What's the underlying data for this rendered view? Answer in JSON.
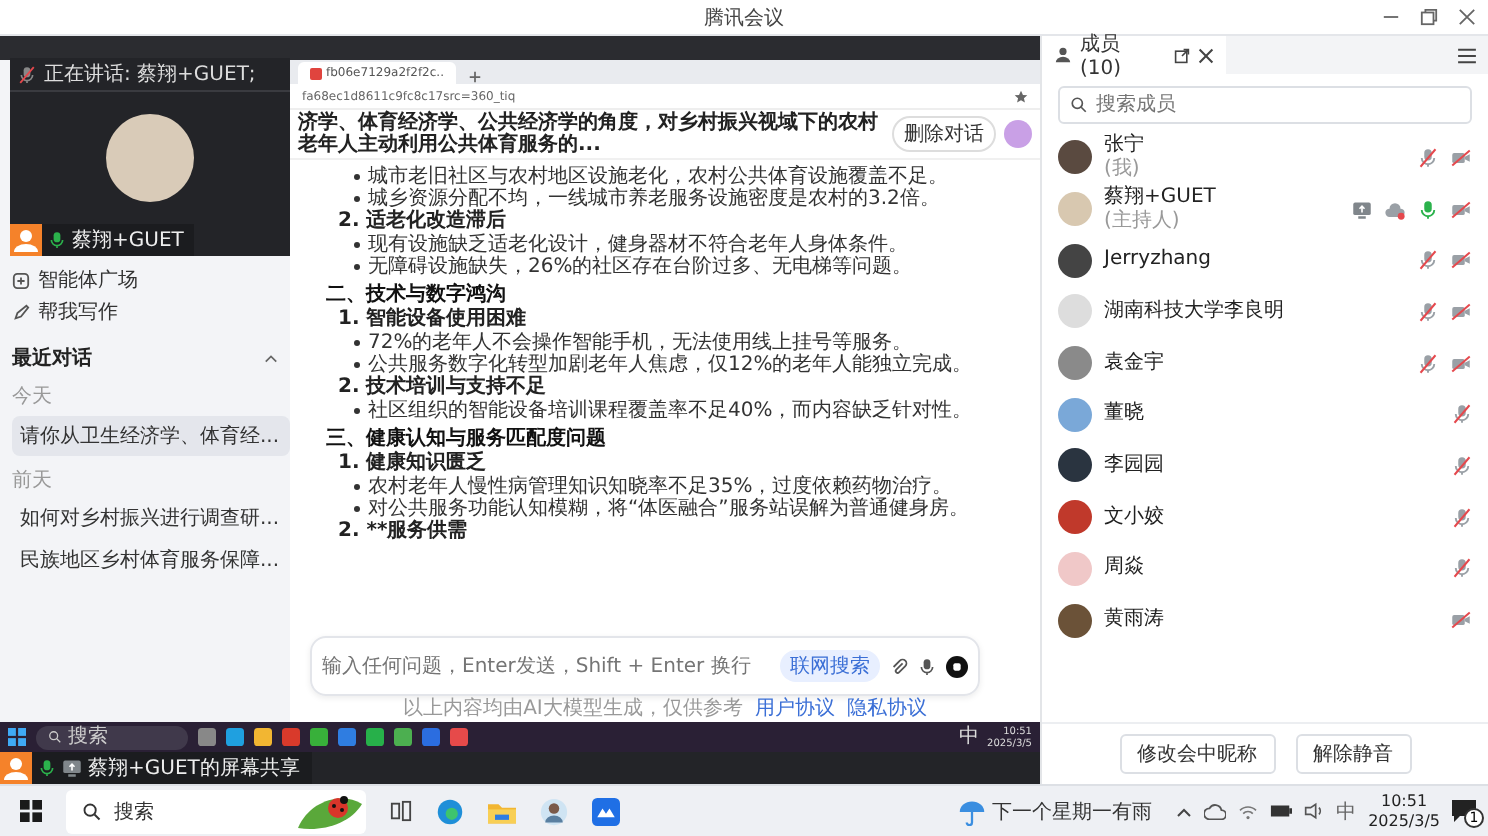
{
  "window": {
    "title": "腾讯会议"
  },
  "speaker_overlay": {
    "speaking": "正在讲话: 蔡翔+GUET;",
    "name": "蔡翔+GUET"
  },
  "share_label": "蔡翔+GUET的屏幕共享",
  "shared_screen": {
    "browser": {
      "tab": "fb06e7129a2f2f2c..",
      "url": "fa68ec1d8611c9fc8c17src=360_tiq"
    },
    "sidebar": {
      "items": [
        {
          "label": "智能体广场"
        },
        {
          "label": "帮我写作"
        }
      ],
      "section": "最近对话",
      "groups": [
        {
          "label": "今天",
          "conversations": [
            {
              "label": "请你从卫生经济学、体育经...",
              "selected": true
            }
          ]
        },
        {
          "label": "前天",
          "conversations": [
            {
              "label": "如何对乡村振兴进行调查研...",
              "selected": false
            },
            {
              "label": "民族地区乡村体育服务保障...",
              "selected": false
            }
          ]
        }
      ]
    },
    "chat_title": "济学、体育经济学、公共经济学的角度，对乡村振兴视域下的农村老年人主动利用公共体育服务的...",
    "delete_button": "删除对话",
    "content": [
      {
        "kind": "bullet",
        "text": "城市老旧社区与农村地区设施老化，农村公共体育设施覆盖不足。"
      },
      {
        "kind": "bullet",
        "text": "城乡资源分配不均，一线城市养老服务设施密度是农村的3.2倍。"
      },
      {
        "kind": "numbered",
        "text": "2. 适老化改造滞后"
      },
      {
        "kind": "bullet",
        "text": "现有设施缺乏适老化设计，健身器材不符合老年人身体条件。"
      },
      {
        "kind": "bullet",
        "text": "无障碍设施缺失，26%的社区存在台阶过多、无电梯等问题。"
      },
      {
        "kind": "heading",
        "text": "二、技术与数字鸿沟"
      },
      {
        "kind": "numbered",
        "text": "1. 智能设备使用困难"
      },
      {
        "kind": "bullet",
        "text": "72%的老年人不会操作智能手机，无法使用线上挂号等服务。"
      },
      {
        "kind": "bullet",
        "text": "公共服务数字化转型加剧老年人焦虑，仅12%的老年人能独立完成。"
      },
      {
        "kind": "numbered",
        "text": "2. 技术培训与支持不足"
      },
      {
        "kind": "bullet",
        "text": "社区组织的智能设备培训课程覆盖率不足40%，而内容缺乏针对性。"
      },
      {
        "kind": "heading",
        "text": "三、健康认知与服务匹配度问题"
      },
      {
        "kind": "numbered",
        "text": "1. 健康知识匮乏"
      },
      {
        "kind": "bullet",
        "text": "农村老年人慢性病管理知识知晓率不足35%，过度依赖药物治疗。"
      },
      {
        "kind": "bullet",
        "text": "对公共服务功能认知模糊，将“体医融合”服务站误解为普通健身房。"
      },
      {
        "kind": "numbered",
        "text": "2. **服务供需"
      }
    ],
    "input": {
      "placeholder": "输入任何问题，Enter发送，Shift + Enter 换行",
      "chip": "联网搜索"
    },
    "footer": "以上内容均由AI大模型生成，仅供参考",
    "footer_links": [
      "用户协议",
      "隐私协议"
    ],
    "taskbar": {
      "search": "搜索",
      "ime": "中",
      "time": "10:51",
      "date": "2025/3/5"
    }
  },
  "members_panel": {
    "tab": "成员(10)",
    "search": {
      "placeholder": "搜索成员"
    },
    "members": [
      {
        "name": "张宁",
        "role": "(我)",
        "audio_connected": true,
        "muted": true,
        "camera_off": true,
        "sharing": false,
        "recording": false
      },
      {
        "name": "蔡翔+GUET",
        "role": "(主持人)",
        "audio_connected": true,
        "muted": false,
        "camera_off": true,
        "sharing": true,
        "recording": true
      },
      {
        "name": "Jerryzhang",
        "audio_connected": true,
        "muted": true,
        "camera_off": true,
        "sharing": false,
        "recording": false
      },
      {
        "name": "湖南科技大学李良明",
        "audio_connected": true,
        "muted": true,
        "camera_off": true,
        "sharing": false,
        "recording": false
      },
      {
        "name": "袁金宇",
        "audio_connected": true,
        "muted": true,
        "camera_off": true,
        "sharing": false,
        "recording": false
      },
      {
        "name": "董晓",
        "audio_connected": true,
        "muted": true,
        "camera_off": false,
        "sharing": false,
        "recording": false
      },
      {
        "name": "李园园",
        "audio_connected": true,
        "muted": true,
        "camera_off": false,
        "sharing": false,
        "recording": false
      },
      {
        "name": "文小姣",
        "audio_connected": true,
        "muted": true,
        "camera_off": false,
        "sharing": false,
        "recording": false
      },
      {
        "name": "周焱",
        "audio_connected": true,
        "muted": true,
        "camera_off": false,
        "sharing": false,
        "recording": false
      },
      {
        "name": "黄雨涛",
        "audio_connected": false,
        "camera_off": true,
        "sharing": false,
        "recording": false
      }
    ],
    "buttons": [
      "修改会中昵称",
      "解除静音"
    ]
  },
  "taskbar": {
    "search": "搜索",
    "weather": "下一个星期一有雨",
    "ime": "中",
    "time": "10:51",
    "date": "2025/3/5",
    "notifications": "1"
  }
}
